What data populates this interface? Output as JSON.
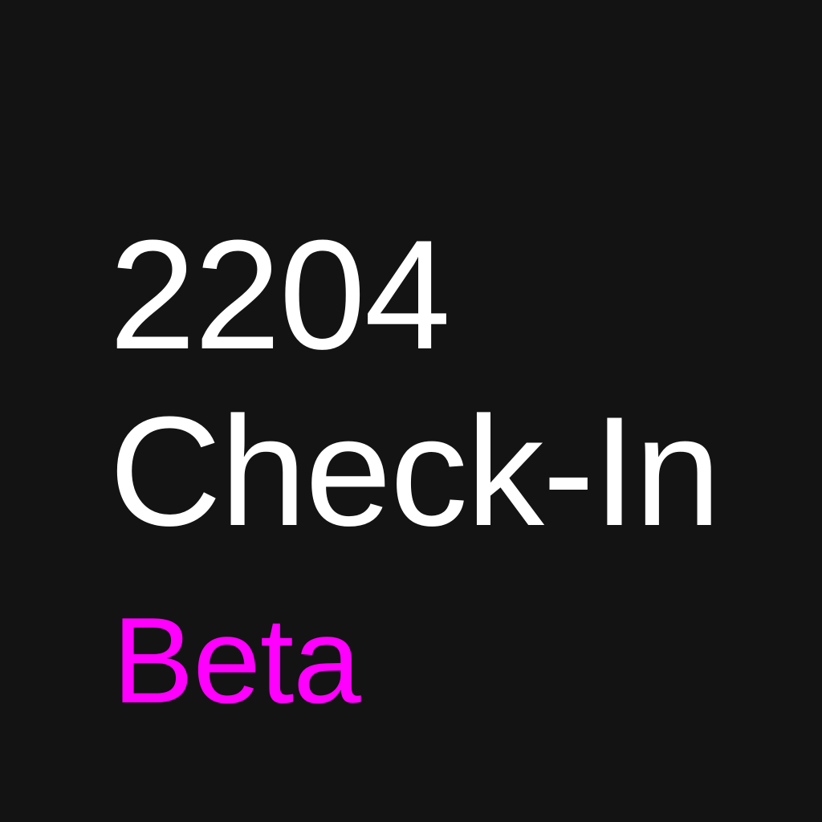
{
  "icon": {
    "title_line_1": "2204",
    "title_line_2": "Check-In",
    "badge": "Beta"
  },
  "colors": {
    "background": "#131313",
    "title": "#ffffff",
    "badge": "#ff00ff"
  }
}
